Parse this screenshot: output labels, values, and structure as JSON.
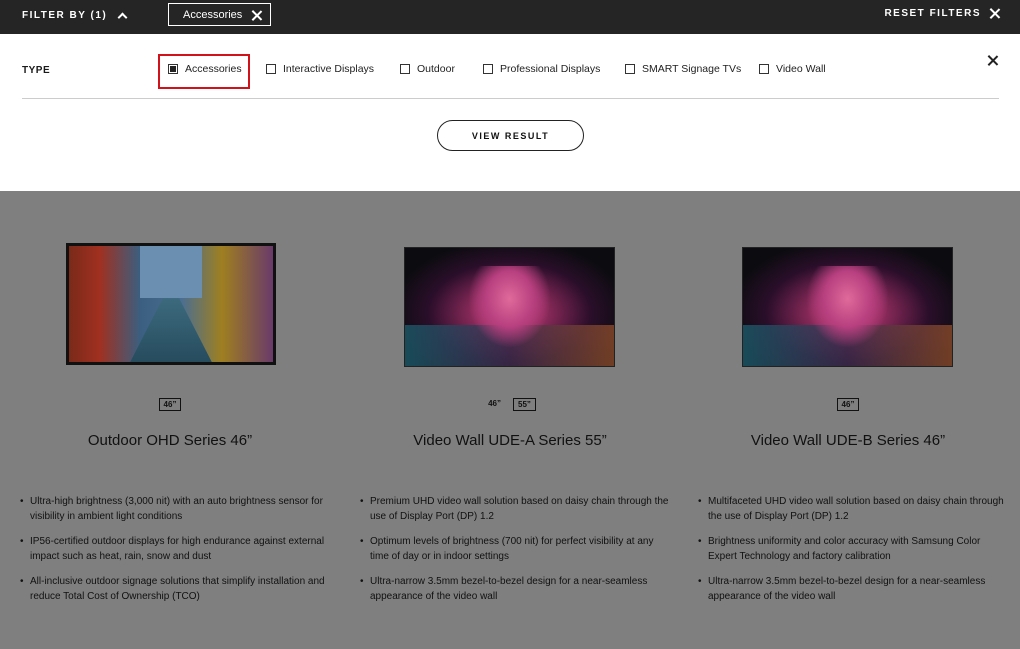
{
  "topbar": {
    "filter_by": "FILTER BY (1)",
    "chip_label": "Accessories",
    "reset_label": "RESET FILTERS"
  },
  "panel": {
    "type_label": "TYPE",
    "options": [
      {
        "label": "Accessories",
        "checked": true
      },
      {
        "label": "Interactive Displays",
        "checked": false
      },
      {
        "label": "Outdoor",
        "checked": false
      },
      {
        "label": "Professional Displays",
        "checked": false
      },
      {
        "label": "SMART Signage TVs",
        "checked": false
      },
      {
        "label": "Video Wall",
        "checked": false
      }
    ],
    "view_result": "VIEW RESULT"
  },
  "products": [
    {
      "title": "Outdoor OHD Series 46”",
      "sizes": [
        "46”"
      ],
      "features": [
        "Ultra-high brightness (3,000 nit) with an auto brightness sensor for visibility in ambient light conditions",
        "IP56-certified outdoor displays for high endurance against external impact such as heat, rain, snow and dust",
        "All-inclusive outdoor signage solutions that simplify installation and reduce Total Cost of Ownership (TCO)"
      ]
    },
    {
      "title": "Video Wall UDE-A Series 55”",
      "sizes": [
        "46”",
        "55”"
      ],
      "features": [
        "Premium UHD video wall solution based on daisy chain through the use of Display Port (DP) 1.2",
        "Optimum levels of brightness (700 nit) for perfect visibility at any time of day or in indoor settings",
        "Ultra-narrow 3.5mm bezel-to-bezel design for a near-seamless appearance of the video wall"
      ]
    },
    {
      "title": "Video Wall UDE-B Series 46”",
      "sizes": [
        "46”"
      ],
      "features": [
        "Multifaceted UHD video wall solution based on daisy chain through the use of Display Port (DP) 1.2",
        "Brightness uniformity and color accuracy with Samsung Color Expert Technology and factory calibration",
        "Ultra-narrow 3.5mm bezel-to-bezel design for a near-seamless appearance of the video wall"
      ]
    }
  ]
}
